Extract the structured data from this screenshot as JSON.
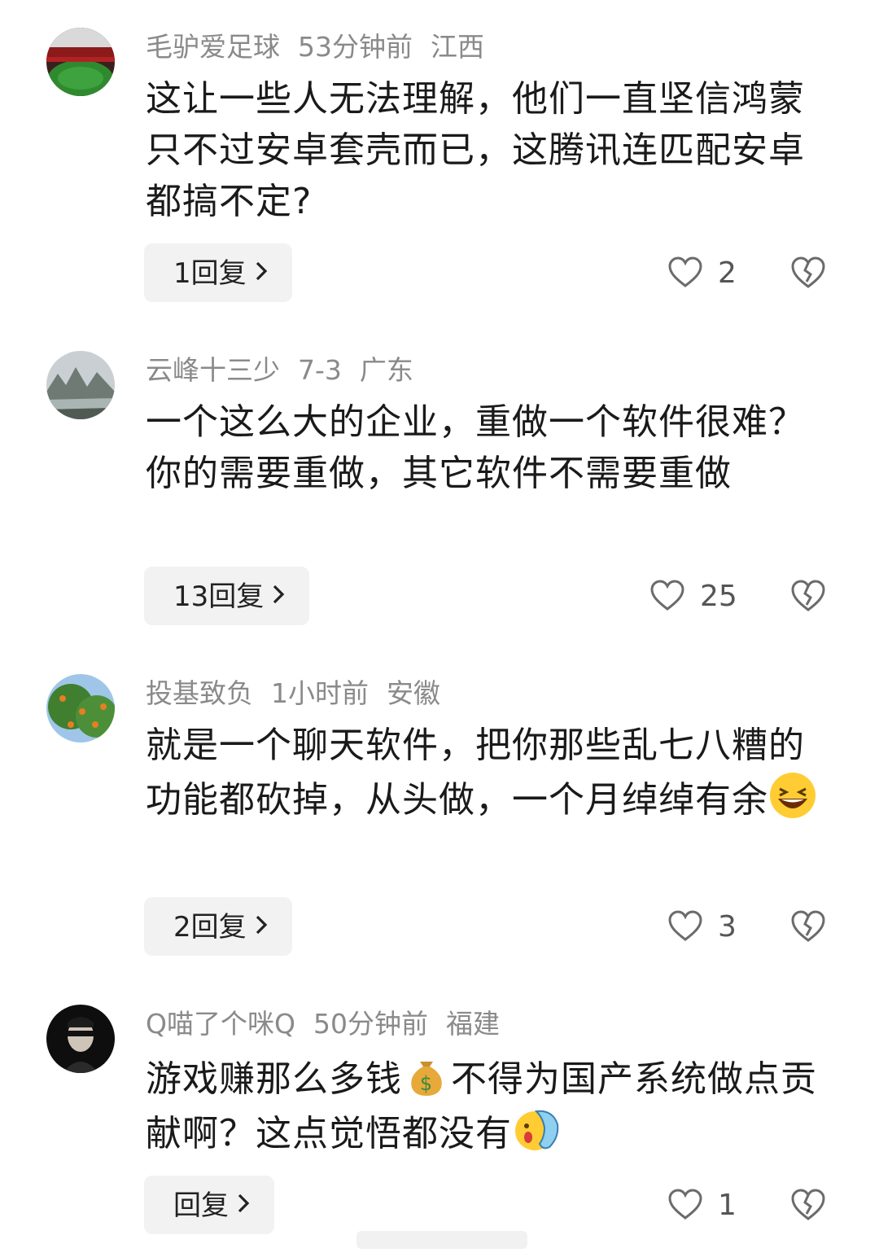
{
  "comments": [
    {
      "username": "毛驴爱足球",
      "time": "53分钟前",
      "location": "江西",
      "text": "这让一些人无法理解，他们一直坚信鸿蒙只不过安卓套壳而已，这腾讯连匹配安卓都搞不定?",
      "reply_label": "1回复",
      "likes": "2",
      "avatar_icon": "stadium-avatar"
    },
    {
      "username": "云峰十三少",
      "time": "7-3",
      "location": "广东",
      "text": "一个这么大的企业，重做一个软件很难？你的需要重做，其它软件不需要重做",
      "reply_label": "13回复",
      "likes": "25",
      "avatar_icon": "mountain-river-avatar"
    },
    {
      "username": "投基致负",
      "time": "1小时前",
      "location": "安徽",
      "text": "就是一个聊天软件，把你那些乱七八糟的功能都砍掉，从头做，一个月绰绰有余",
      "reply_label": "2回复",
      "likes": "3",
      "avatar_icon": "orange-tree-avatar",
      "trailing_emoji": "laughing-emoji"
    },
    {
      "username": "Q喵了个咪Q",
      "time": "50分钟前",
      "location": "福建",
      "text_parts": [
        "游戏赚那么多钱",
        "不得为国产系统做点贡献啊？这点觉悟都没有"
      ],
      "reply_label": "回复",
      "likes": "1",
      "avatar_icon": "dark-portrait-avatar",
      "inline_emoji": "money-bag-emoji",
      "trailing_emoji": "slap-face-emoji"
    }
  ],
  "icons": {
    "like": "heart-outline-icon",
    "dislike": "broken-heart-icon",
    "chevron": "chevron-right-icon"
  },
  "colors": {
    "meta_text": "#8a8a8a",
    "reply_bg": "#f2f2f2",
    "icon_stroke": "#6b6b6b"
  }
}
